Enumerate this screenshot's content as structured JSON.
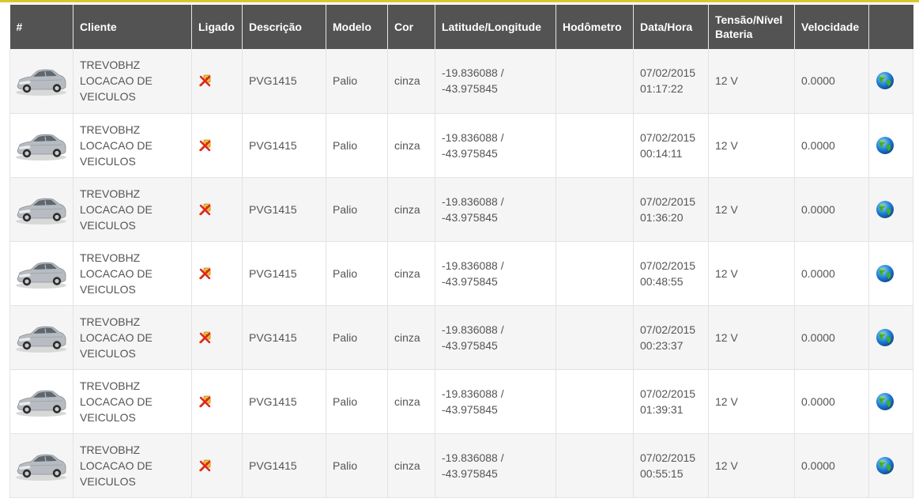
{
  "colors": {
    "header_bg": "#535353",
    "header_text": "#ffffff",
    "row_alt": "#f5f5f5",
    "top_accent": "#d8c830"
  },
  "table": {
    "headers": [
      "#",
      "Cliente",
      "Ligado",
      "Descrição",
      "Modelo",
      "Cor",
      "Latitude/Longitude",
      "Hodômetro",
      "Data/Hora",
      "Tensão/Nível Bateria",
      "Velocidade",
      ""
    ],
    "rows": [
      {
        "icon": "car-icon",
        "cliente": [
          "TREVOBHZ",
          "LOCACAO DE",
          "VEICULOS"
        ],
        "ligado_icon": "ignition-off-icon",
        "descricao": "PVG1415",
        "modelo": "Palio",
        "cor": "cinza",
        "latlon": [
          "-19.836088 /",
          "-43.975845"
        ],
        "hodometro": "",
        "data": "07/02/2015",
        "hora": "01:17:22",
        "tensao": "12 V",
        "velocidade": "0.0000",
        "action_icon": "globe-icon"
      },
      {
        "icon": "car-icon",
        "cliente": [
          "TREVOBHZ",
          "LOCACAO DE",
          "VEICULOS"
        ],
        "ligado_icon": "ignition-off-icon",
        "descricao": "PVG1415",
        "modelo": "Palio",
        "cor": "cinza",
        "latlon": [
          "-19.836088 /",
          "-43.975845"
        ],
        "hodometro": "",
        "data": "07/02/2015",
        "hora": "00:14:11",
        "tensao": "12 V",
        "velocidade": "0.0000",
        "action_icon": "globe-icon"
      },
      {
        "icon": "car-icon",
        "cliente": [
          "TREVOBHZ",
          "LOCACAO DE",
          "VEICULOS"
        ],
        "ligado_icon": "ignition-off-icon",
        "descricao": "PVG1415",
        "modelo": "Palio",
        "cor": "cinza",
        "latlon": [
          "-19.836088 /",
          "-43.975845"
        ],
        "hodometro": "",
        "data": "07/02/2015",
        "hora": "01:36:20",
        "tensao": "12 V",
        "velocidade": "0.0000",
        "action_icon": "globe-icon"
      },
      {
        "icon": "car-icon",
        "cliente": [
          "TREVOBHZ",
          "LOCACAO DE",
          "VEICULOS"
        ],
        "ligado_icon": "ignition-off-icon",
        "descricao": "PVG1415",
        "modelo": "Palio",
        "cor": "cinza",
        "latlon": [
          "-19.836088 /",
          "-43.975845"
        ],
        "hodometro": "",
        "data": "07/02/2015",
        "hora": "00:48:55",
        "tensao": "12 V",
        "velocidade": "0.0000",
        "action_icon": "globe-icon"
      },
      {
        "icon": "car-icon",
        "cliente": [
          "TREVOBHZ",
          "LOCACAO DE",
          "VEICULOS"
        ],
        "ligado_icon": "ignition-off-icon",
        "descricao": "PVG1415",
        "modelo": "Palio",
        "cor": "cinza",
        "latlon": [
          "-19.836088 /",
          "-43.975845"
        ],
        "hodometro": "",
        "data": "07/02/2015",
        "hora": "00:23:37",
        "tensao": "12 V",
        "velocidade": "0.0000",
        "action_icon": "globe-icon"
      },
      {
        "icon": "car-icon",
        "cliente": [
          "TREVOBHZ",
          "LOCACAO DE",
          "VEICULOS"
        ],
        "ligado_icon": "ignition-off-icon",
        "descricao": "PVG1415",
        "modelo": "Palio",
        "cor": "cinza",
        "latlon": [
          "-19.836088 /",
          "-43.975845"
        ],
        "hodometro": "",
        "data": "07/02/2015",
        "hora": "01:39:31",
        "tensao": "12 V",
        "velocidade": "0.0000",
        "action_icon": "globe-icon"
      },
      {
        "icon": "car-icon",
        "cliente": [
          "TREVOBHZ",
          "LOCACAO DE",
          "VEICULOS"
        ],
        "ligado_icon": "ignition-off-icon",
        "descricao": "PVG1415",
        "modelo": "Palio",
        "cor": "cinza",
        "latlon": [
          "-19.836088 /",
          "-43.975845"
        ],
        "hodometro": "",
        "data": "07/02/2015",
        "hora": "00:55:15",
        "tensao": "12 V",
        "velocidade": "0.0000",
        "action_icon": "globe-icon"
      }
    ]
  }
}
